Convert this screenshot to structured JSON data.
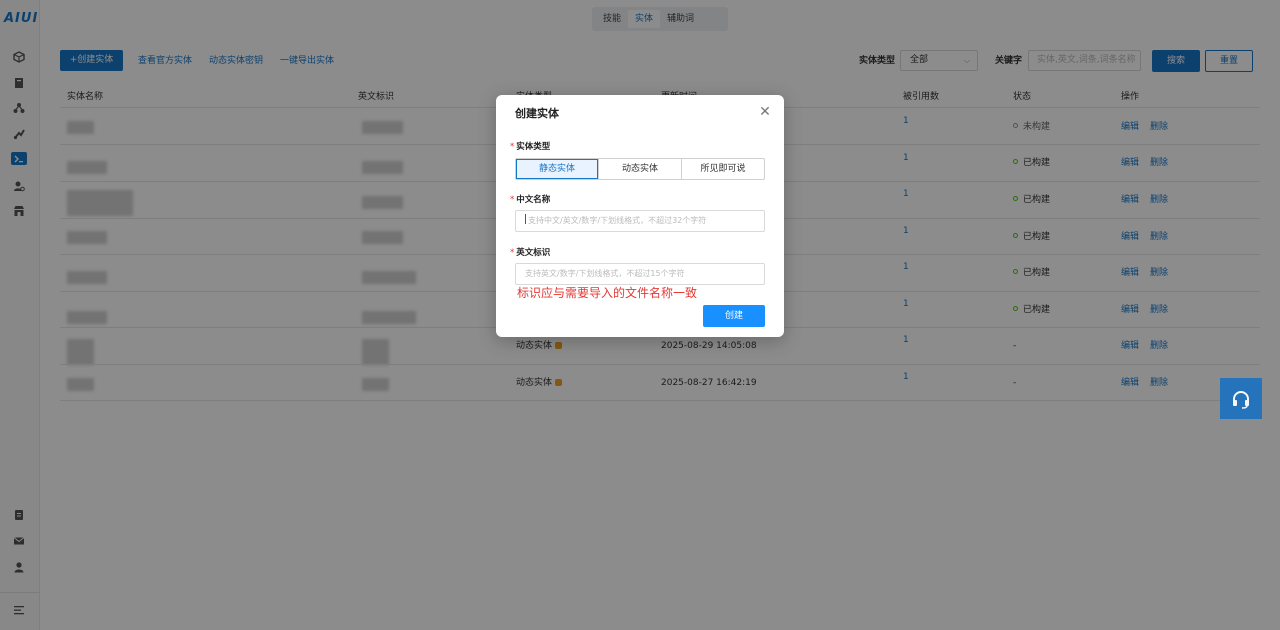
{
  "brand": {
    "logo": "AIUI",
    "accent": "#1677c8"
  },
  "sidebar": {
    "icons": [
      "cube-icon",
      "book-icon",
      "sitemap-icon",
      "flask-icon",
      "entity-icon",
      "user-gear-icon",
      "store-icon",
      "document-icon",
      "mail-icon",
      "user-icon",
      "menu-collapse-icon"
    ]
  },
  "top_tabs": [
    {
      "label": "技能",
      "active": false
    },
    {
      "label": "实体",
      "active": true
    },
    {
      "label": "辅助词",
      "active": false
    }
  ],
  "toolbar": {
    "create_label": "+创建实体",
    "view_official": "查看官方实体",
    "dynamic_key": "动态实体密钥",
    "export": "一键导出实体",
    "type_label": "实体类型",
    "type_value": "全部",
    "keyword_label": "关键字",
    "keyword_placeholder": "实体,英文,词条,词条名称",
    "search_label": "搜索",
    "reset_label": "重置"
  },
  "table": {
    "headers": {
      "cn_name": "实体名称",
      "en_id": "英文标识",
      "type": "实体类型",
      "updated": "更新时间",
      "refs": "被引用数",
      "status": "状态",
      "ops": "操作"
    },
    "rows": [
      {
        "type": "",
        "updated": "",
        "refs": "1",
        "status": "未构建",
        "built": false,
        "edit": "编辑",
        "delete": "删除"
      },
      {
        "type": "",
        "updated": "",
        "refs": "1",
        "status": "已构建",
        "built": true,
        "edit": "编辑",
        "delete": "删除"
      },
      {
        "type": "",
        "updated": "",
        "refs": "1",
        "status": "已构建",
        "built": true,
        "edit": "编辑",
        "delete": "删除"
      },
      {
        "type": "",
        "updated": "",
        "refs": "1",
        "status": "已构建",
        "built": true,
        "edit": "编辑",
        "delete": "删除"
      },
      {
        "type": "",
        "updated": "",
        "refs": "1",
        "status": "已构建",
        "built": true,
        "edit": "编辑",
        "delete": "删除"
      },
      {
        "type": "",
        "updated": "",
        "refs": "1",
        "status": "已构建",
        "built": true,
        "edit": "编辑",
        "delete": "删除"
      },
      {
        "type": "动态实体",
        "updated": "2025-08-29 14:05:08",
        "refs": "1",
        "status": "-",
        "built": null,
        "edit": "编辑",
        "delete": "删除"
      },
      {
        "type": "动态实体",
        "updated": "2025-08-27 16:42:19",
        "refs": "1",
        "status": "-",
        "built": null,
        "edit": "编辑",
        "delete": "删除"
      }
    ]
  },
  "modal": {
    "title": "创建实体",
    "type_label": "实体类型",
    "type_options": [
      {
        "label": "静态实体",
        "active": true
      },
      {
        "label": "动态实体",
        "active": false
      },
      {
        "label": "所见即可说",
        "active": false
      }
    ],
    "cn_label": "中文名称",
    "cn_placeholder": "支持中文/英文/数字/下划线格式，不超过32个字符",
    "en_label": "英文标识",
    "en_placeholder": "支持英文/数字/下划线格式，不超过15个字符",
    "annotation": "标识应与需要导入的文件名称一致",
    "create_label": "创建"
  }
}
